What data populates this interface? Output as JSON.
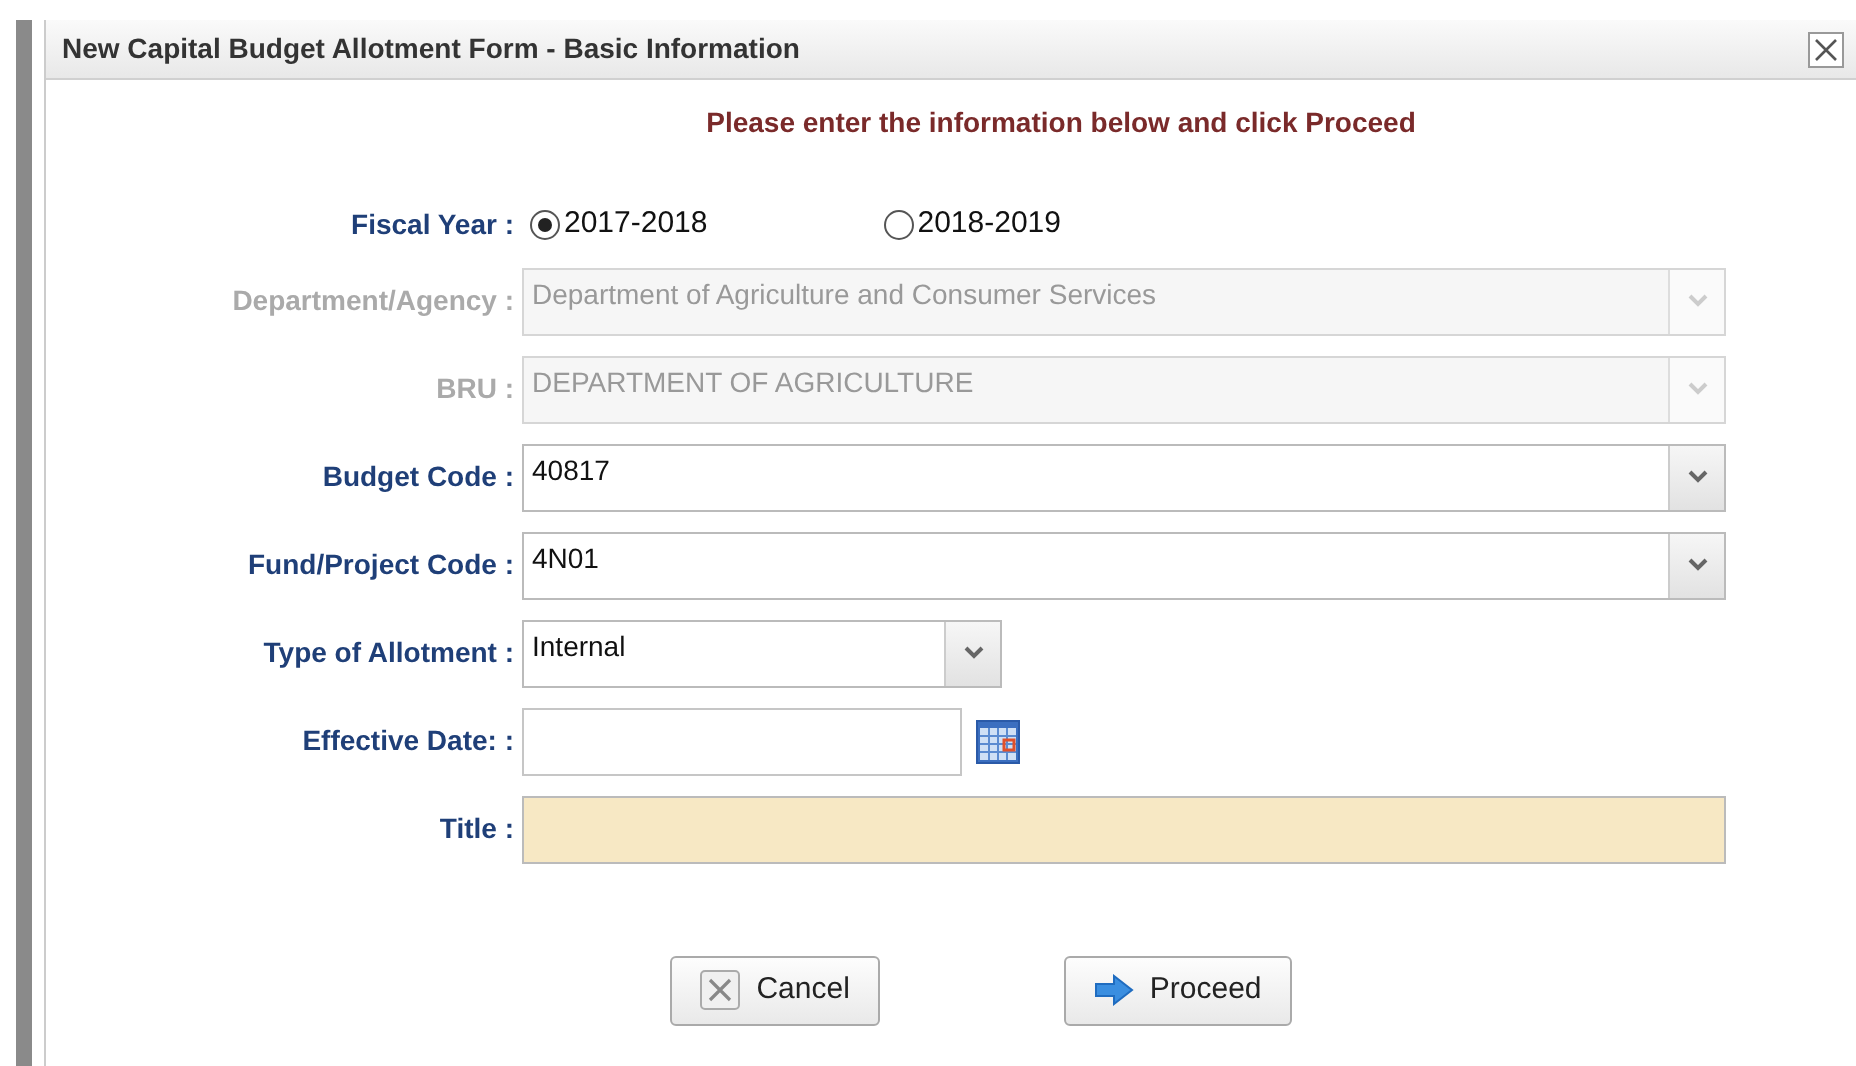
{
  "window": {
    "title": "New Capital Budget Allotment Form - Basic Information"
  },
  "instruction": "Please enter the information below and click Proceed",
  "fiscal_year": {
    "label": "Fiscal Year :",
    "options": [
      {
        "label": "2017-2018",
        "selected": true
      },
      {
        "label": "2018-2019",
        "selected": false
      }
    ]
  },
  "fields": [
    {
      "label": "Department/Agency :",
      "kind": "select",
      "disabled": true,
      "value": "Department of Agriculture and Consumer Services"
    },
    {
      "label": "BRU :",
      "kind": "select",
      "disabled": true,
      "value": "DEPARTMENT OF AGRICULTURE"
    },
    {
      "label": "Budget Code :",
      "kind": "select",
      "disabled": false,
      "value": "40817"
    },
    {
      "label": "Fund/Project Code :",
      "kind": "select",
      "disabled": false,
      "value": "4N01"
    },
    {
      "label": "Type of Allotment :",
      "kind": "short_select",
      "disabled": false,
      "value": "Internal"
    },
    {
      "label": "Effective Date:  :",
      "kind": "date",
      "disabled": false
    },
    {
      "label": "Title :",
      "kind": "text",
      "disabled": false,
      "required": true
    }
  ],
  "buttons": [
    {
      "label": "Cancel",
      "kind": "cancel"
    },
    {
      "label": "Proceed",
      "kind": "proceed"
    }
  ]
}
